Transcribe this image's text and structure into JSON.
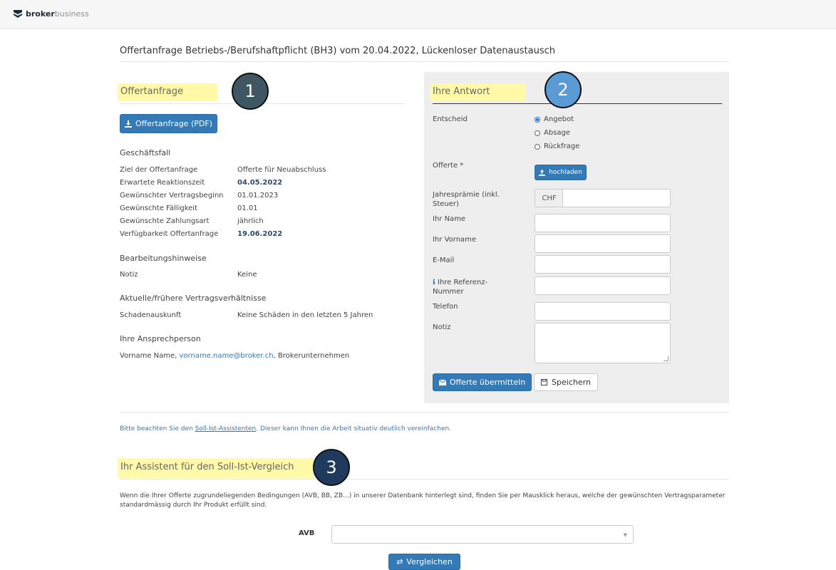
{
  "header": {
    "brand_bold": "broker",
    "brand_light": "business"
  },
  "page_title": "Offertanfrage Betriebs-/Berufshaftpflicht (BH3) vom 20.04.2022, Lückenloser Datenaustausch",
  "badges": {
    "one": "1",
    "two": "2",
    "three": "3"
  },
  "left": {
    "heading": "Offertanfrage",
    "pdf_button": "Offertanfrage (PDF)",
    "section_case": "Geschäftsfall",
    "rows": [
      {
        "label": "Ziel der Offertanfrage",
        "value": "Offerte für Neuabschluss"
      },
      {
        "label": "Erwartete Reaktionszeit",
        "value": "04.05.2022"
      },
      {
        "label": "Gewünschter Vertragsbeginn",
        "value": "01.01.2023"
      },
      {
        "label": "Gewünschte Fälligkeit",
        "value": "01.01"
      },
      {
        "label": "Gewünschte Zahlungsart",
        "value": "jährlich"
      },
      {
        "label": "Verfügbarkeit Offertanfrage",
        "value": "19.06.2022"
      }
    ],
    "section_notes": "Bearbeitungshinweise",
    "note_label": "Notiz",
    "note_value": "Keine",
    "section_contracts": "Aktuelle/frühere Vertragsverhältnisse",
    "damage_label": "Schadenauskunft",
    "damage_value": "Keine Schäden in den letzten 5 Jahren",
    "section_contact": "Ihre Ansprechperson",
    "contact_name": "Vorname Name, ",
    "contact_email": "vorname.name@broker.ch",
    "contact_company": ", Brokerunternehmen"
  },
  "right": {
    "heading": "Ihre Antwort",
    "decision_label": "Entscheid",
    "options": [
      "Angebot",
      "Absage",
      "Rückfrage"
    ],
    "selected_option": "Angebot",
    "offer_label": "Offerte *",
    "upload_button": "hochladen",
    "premium_label": "Jahresprämie (inkl. Steuer)",
    "currency": "CHF",
    "name_label": "Ihr Name",
    "firstname_label": "Ihr Vorname",
    "email_label": "E-Mail",
    "ref_label": "Ihre Referenz-Nummer",
    "phone_label": "Telefon",
    "note_label": "Notiz",
    "submit_button": "Offerte übermitteln",
    "save_button": "Speichern"
  },
  "hint": {
    "before": "Bitte beachten Sie den ",
    "link": "Soll-Ist-Assistenten",
    "after": ". Dieser kann Ihnen die Arbeit situativ deutlich vereinfachen."
  },
  "assistant": {
    "heading": "Ihr Assistent für den Soll-Ist-Vergleich",
    "description": "Wenn die Ihrer Offerte zugrundeliegenden Bedingungen (AVB, BB, ZB...) in unserer Datenbank hinterlegt sind, finden Sie per Mausklick heraus, welche der gewünschten Vertragsparameter standardmässig durch Ihr Produkt erfüllt sind.",
    "avb_label": "AVB",
    "compare_button": "Vergleichen"
  },
  "colors": {
    "primary": "#337ab7",
    "highlight": "#fff9a8",
    "badge1": "#3f5663",
    "badge2": "#5b9bd5",
    "badge3": "#1f3a5c"
  }
}
